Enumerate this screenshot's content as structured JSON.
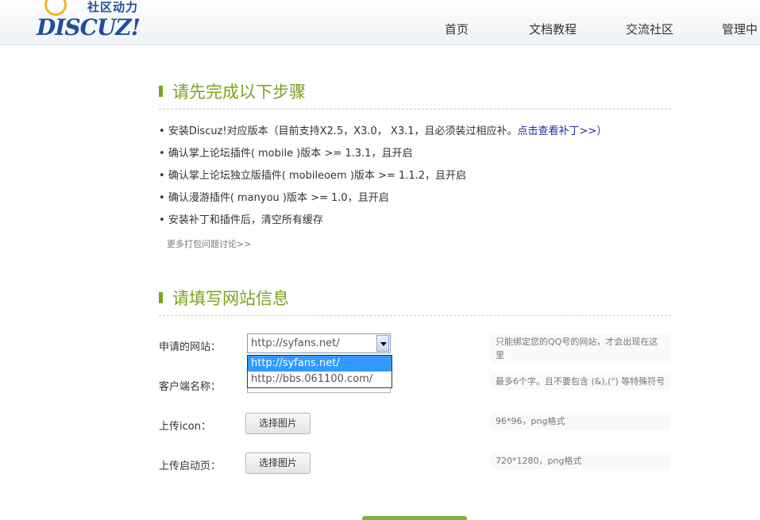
{
  "brand": {
    "logo_sub": "社区动力",
    "logo_main": "DISCUZ!"
  },
  "nav": {
    "items": [
      "首页",
      "文档教程",
      "交流社区",
      "管理中"
    ]
  },
  "steps": {
    "title": "请先完成以下步骤",
    "items": [
      {
        "text": "安装Discuz!对应版本（目前支持X2.5，X3.0， X3.1，且必须装过相应补。",
        "link": "点击查看补丁>>",
        "after": "）"
      },
      {
        "text": "确认掌上论坛插件( mobile )版本 >= 1.3.1，且开启"
      },
      {
        "text": "确认掌上论坛独立版插件( mobileoem )版本 >= 1.1.2，且开启"
      },
      {
        "text": "确认漫游插件( manyou )版本 >= 1.0，且开启"
      },
      {
        "text": "安装补丁和插件后，清空所有缓存"
      }
    ],
    "more_link": "更多打包问题讨论>>"
  },
  "site_form": {
    "title": "请填写网站信息",
    "site_label": "申请的网站：",
    "site_selected": "http://syfans.net/",
    "site_options": [
      "http://syfans.net/",
      "http://bbs.061100.com/"
    ],
    "site_hint": "只能绑定您的QQ号的网站，才会出现在这里",
    "client_label": "客户端名称：",
    "client_value": "",
    "client_hint": "最多6个字。且不要包含 (&),(\") 等特殊符号",
    "icon_label": "上传icon：",
    "icon_button": "选择图片",
    "icon_hint": "96*96，png格式",
    "splash_label": "上传启动页：",
    "splash_button": "选择图片",
    "splash_hint": "720*1280，png格式"
  },
  "colors": {
    "accent_green": "#7aa320",
    "brand_blue": "#1f4e99",
    "link_blue": "#1d2c9c",
    "select_highlight": "#3399ff"
  }
}
